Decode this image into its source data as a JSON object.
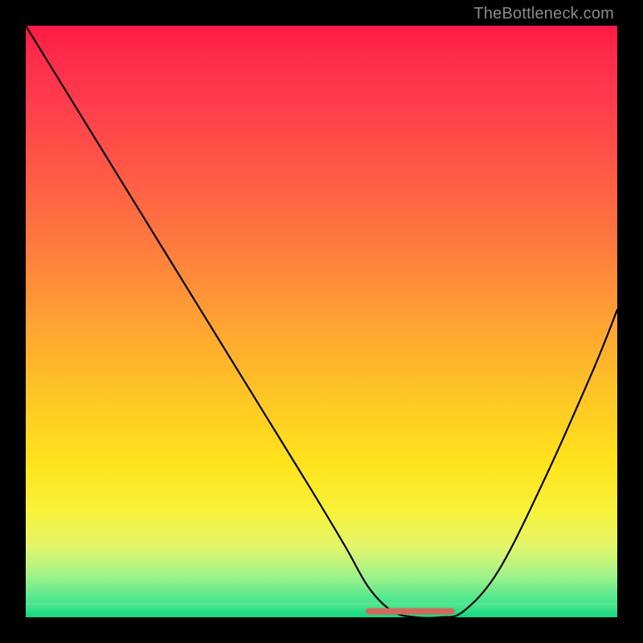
{
  "watermark": "TheBottleneck.com",
  "chart_data": {
    "type": "line",
    "title": "",
    "xlabel": "",
    "ylabel": "",
    "xlim": [
      0,
      100
    ],
    "ylim": [
      0,
      100
    ],
    "grid": false,
    "legend": false,
    "background_gradient": {
      "stops": [
        {
          "pos": 0.0,
          "color": "#ff1a45"
        },
        {
          "pos": 0.25,
          "color": "#ff5a46"
        },
        {
          "pos": 0.5,
          "color": "#ffa233"
        },
        {
          "pos": 0.74,
          "color": "#ffe31c"
        },
        {
          "pos": 0.88,
          "color": "#e4f56a"
        },
        {
          "pos": 1.0,
          "color": "#1ee18a"
        }
      ]
    },
    "series": [
      {
        "name": "bottleneck-curve",
        "color": "#000000",
        "x": [
          0,
          8,
          16,
          24,
          32,
          40,
          48,
          54,
          58,
          62,
          66,
          70,
          74,
          80,
          88,
          96,
          100
        ],
        "y": [
          100,
          87,
          74,
          61,
          48,
          35,
          22,
          12,
          5,
          1,
          0,
          0,
          1,
          8,
          24,
          42,
          52
        ]
      },
      {
        "name": "optimal-range-marker",
        "color": "#d06a5f",
        "x": [
          58,
          72
        ],
        "y": [
          1,
          1
        ]
      }
    ],
    "annotations": []
  }
}
